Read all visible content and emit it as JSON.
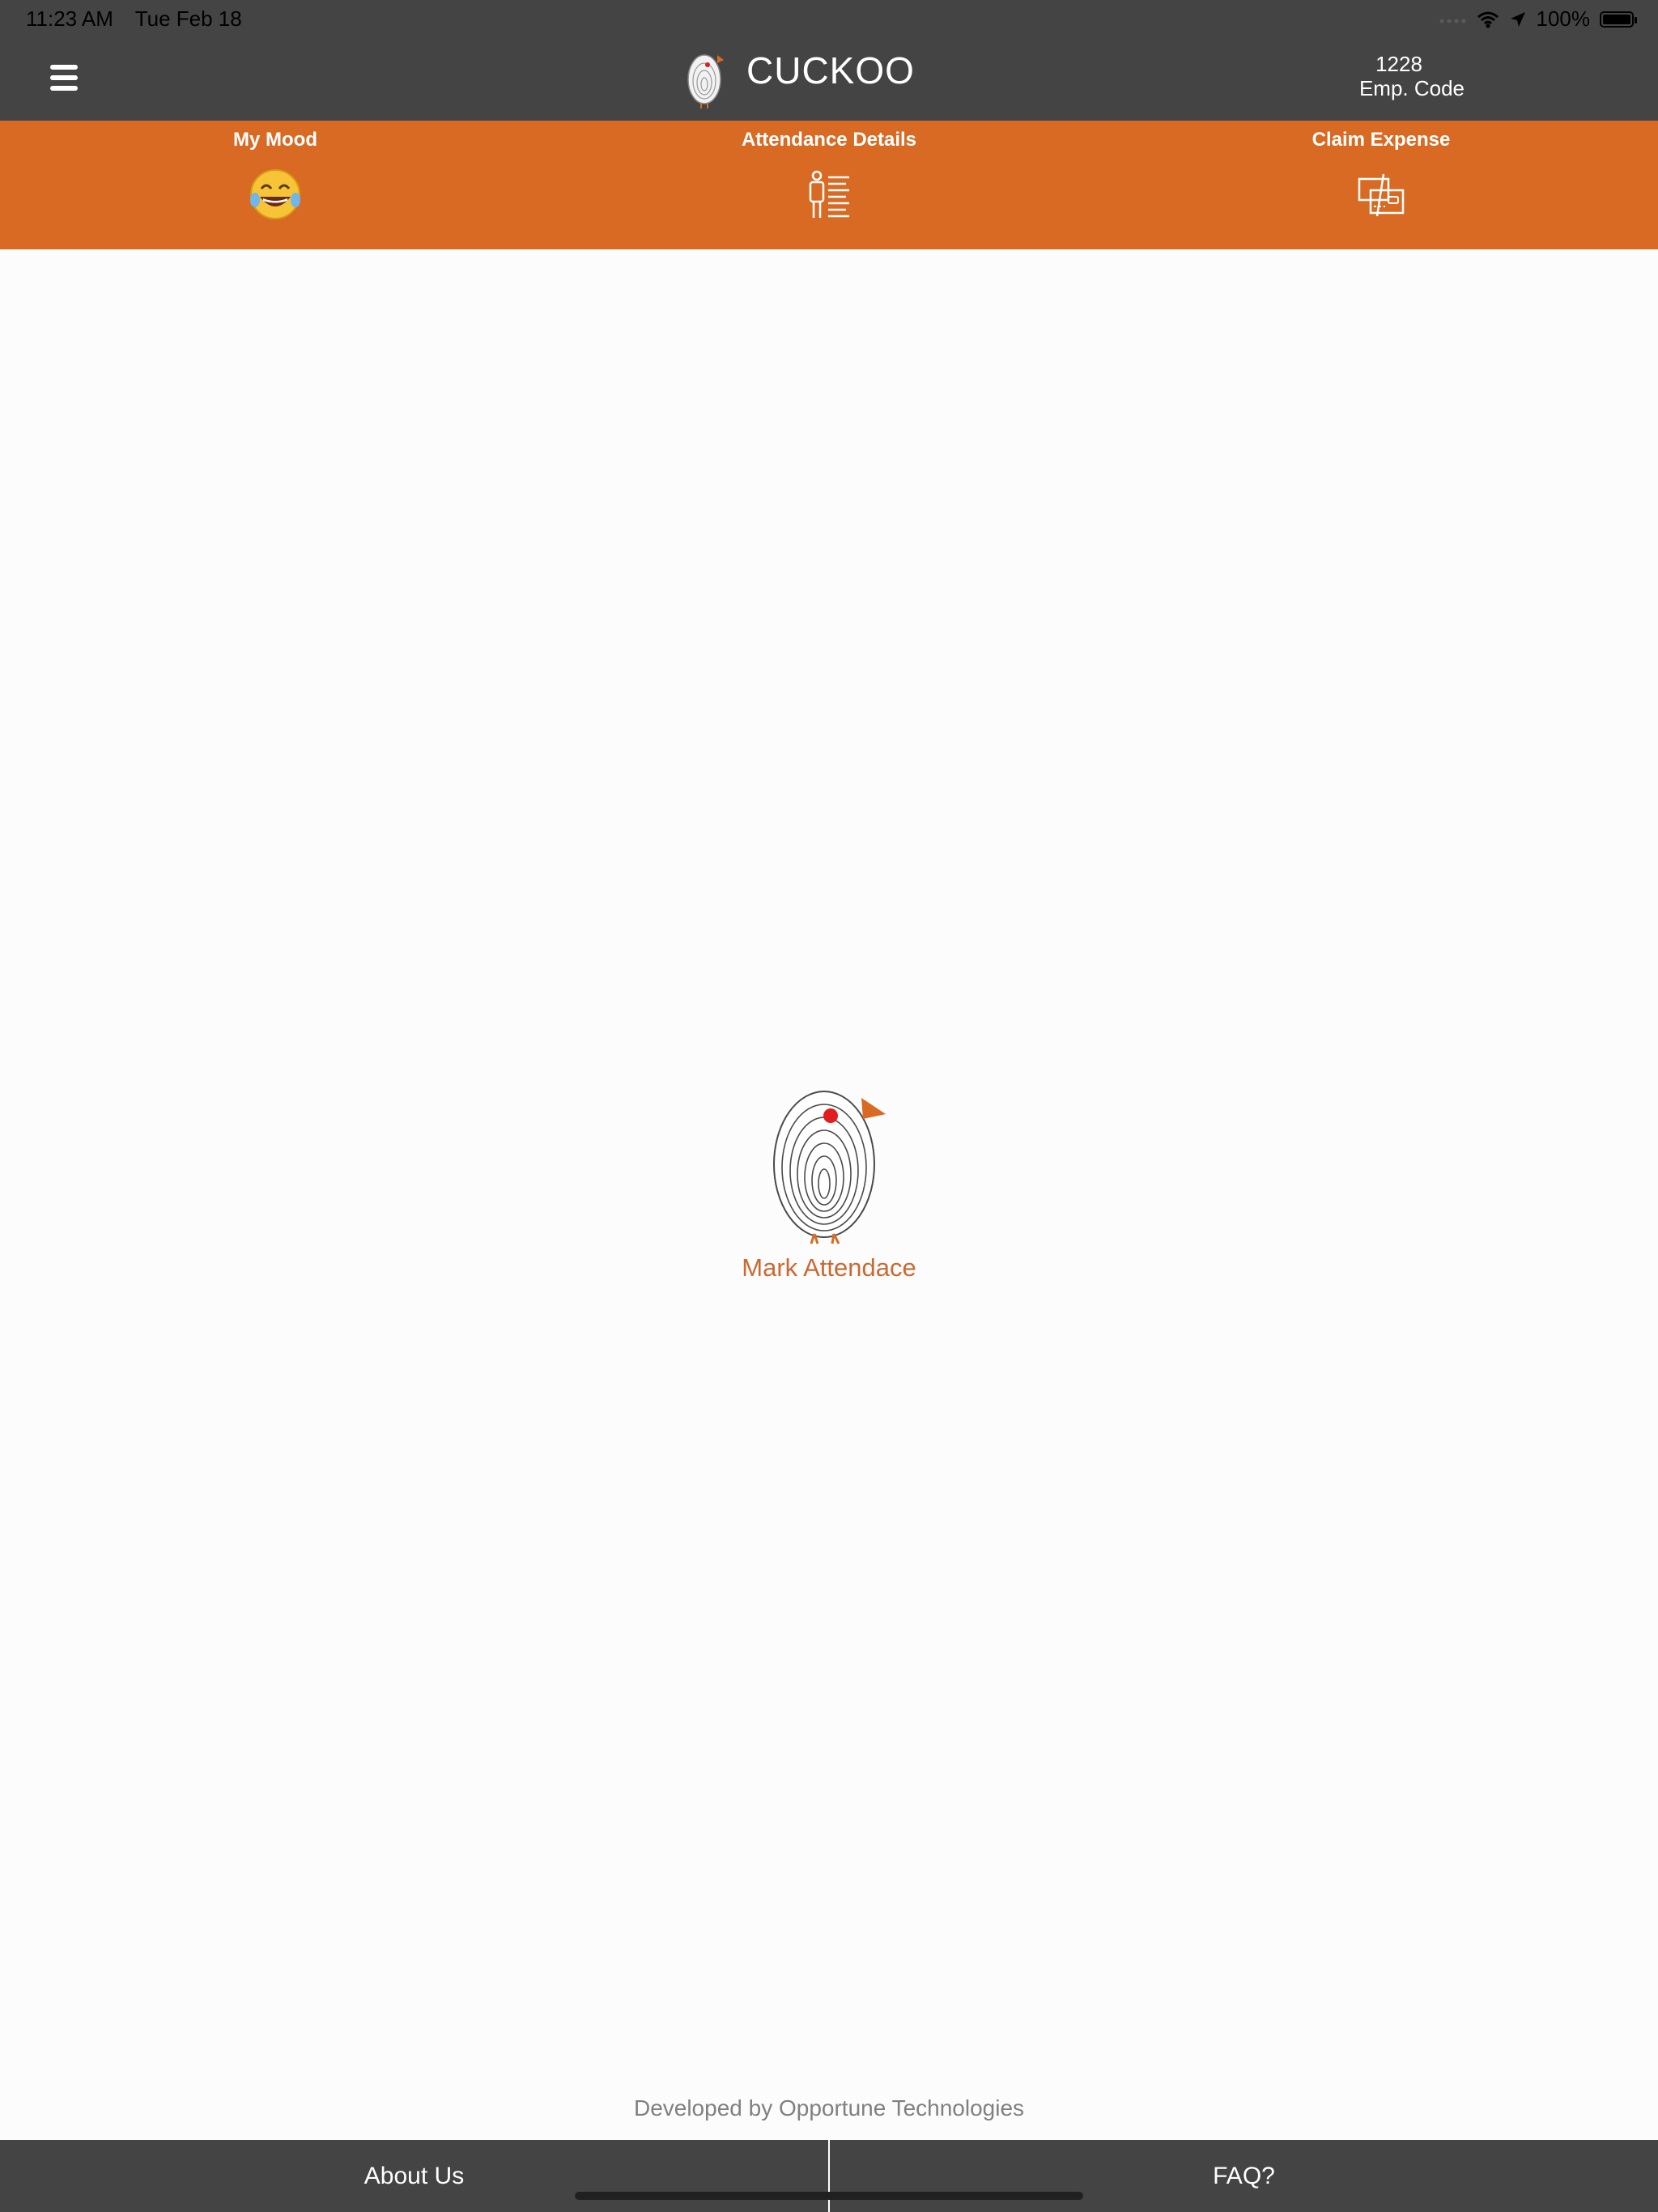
{
  "status_bar": {
    "time": "11:23 AM",
    "date": "Tue Feb 18",
    "battery": "100%",
    "icons": [
      "signal-icon",
      "wifi-icon",
      "location-icon",
      "battery-icon"
    ]
  },
  "header": {
    "title": "CUCKOO",
    "emp_code": "1228",
    "emp_code_label": "Emp. Code"
  },
  "actions": [
    {
      "label": "My Mood",
      "icon": "laughing-emoji-icon"
    },
    {
      "label": "Attendance Details",
      "icon": "attendance-list-icon"
    },
    {
      "label": "Claim Expense",
      "icon": "claim-expense-icon"
    }
  ],
  "main": {
    "mark_attendance_label": "Mark Attendace"
  },
  "footer": {
    "credit": "Developed by Opportune Technologies",
    "about_label": "About Us",
    "faq_label": "FAQ?"
  },
  "colors": {
    "bar_dark": "#444444",
    "accent_orange": "#d86a24",
    "link_orange": "#c96a32",
    "background": "#fcfcfc"
  }
}
